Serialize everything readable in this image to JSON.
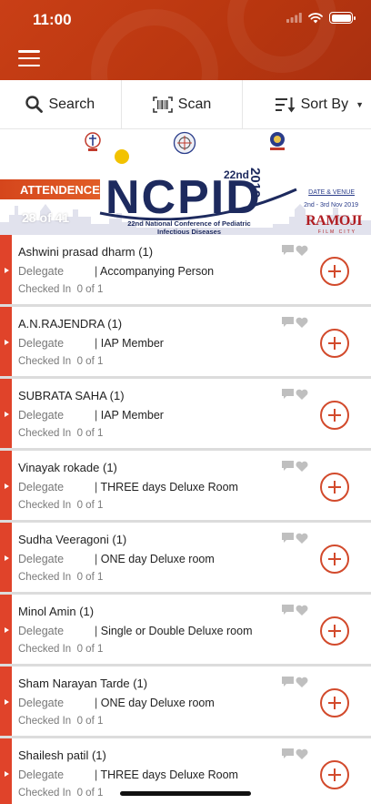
{
  "status_bar": {
    "time": "11:00"
  },
  "toolbar": {
    "search_label": "Search",
    "scan_label": "Scan",
    "sort_label": "Sort By"
  },
  "banner": {
    "section_label": "ATTENDENCE",
    "date_badge": "28 of 41",
    "edition": "22nd",
    "logo_text": "NCPID",
    "year": "2019",
    "conference_line1": "22nd National Conference of Pediatric",
    "conference_line2": "Infectious Diseases",
    "venue_label": "DATE & VENUE",
    "venue_dates": "2nd - 3rd Nov 2019",
    "venue_brand": "RAMOJI",
    "venue_brand_sub": "FILM CITY"
  },
  "attendees": [
    {
      "name": "Ashwini prasad dharm (1)",
      "type": "Delegate",
      "category": "Accompanying Person",
      "checked_label": "Checked In",
      "checked_value": "0 of 1"
    },
    {
      "name": "A.N.RAJENDRA (1)",
      "type": "Delegate",
      "category": "IAP Member",
      "checked_label": "Checked In",
      "checked_value": "0 of 1"
    },
    {
      "name": "SUBRATA SAHA (1)",
      "type": "Delegate",
      "category": "IAP Member",
      "checked_label": "Checked In",
      "checked_value": "0 of 1"
    },
    {
      "name": "Vinayak rokade (1)",
      "type": "Delegate",
      "category": "THREE days Deluxe Room",
      "checked_label": "Checked In",
      "checked_value": "0 of 1"
    },
    {
      "name": "Sudha Veeragoni  (1)",
      "type": "Delegate",
      "category": "ONE day Deluxe room",
      "checked_label": "Checked In",
      "checked_value": "0 of 1"
    },
    {
      "name": "Minol Amin (1)",
      "type": "Delegate",
      "category": "Single or Double Deluxe room",
      "checked_label": "Checked In",
      "checked_value": "0 of 1"
    },
    {
      "name": "Sham Narayan Tarde (1)",
      "type": "Delegate",
      "category": "ONE day Deluxe room",
      "checked_label": "Checked In",
      "checked_value": "0 of 1"
    },
    {
      "name": "Shailesh patil (1)",
      "type": "Delegate",
      "category": "THREE days Deluxe Room",
      "checked_label": "Checked In",
      "checked_value": "0 of 1"
    }
  ],
  "colors": {
    "header": "#c13a12",
    "accent": "#e0432a",
    "add_button": "#d24a2c"
  }
}
